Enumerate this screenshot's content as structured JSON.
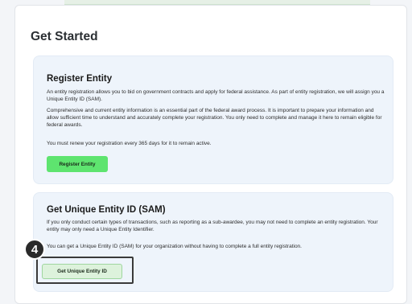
{
  "page": {
    "title": "Get Started"
  },
  "register_entity": {
    "title": "Register Entity",
    "paragraph_1": "An entity registration allows you to bid on government contracts and apply for federal assistance. As part of entity registration, we will assign you a Unique Entity ID (SAM).",
    "paragraph_2": "Comprehensive and current entity information is an essential part of the federal award process. It is important to prepare your information and allow sufficient time to understand and accurately complete your registration. You only need to complete and manage it here to remain eligible for federal awards.",
    "paragraph_3": "You must renew your registration every 365 days for it to remain active.",
    "button_label": "Register Entity"
  },
  "unique_entity_id": {
    "title": "Get Unique Entity ID (SAM)",
    "paragraph_1": "If you only conduct certain types of transactions, such as reporting as a sub-awardee, you may not need to complete an entity registration. Your entity may only need a Unique Entity Identifier.",
    "paragraph_2": "You can get a Unique Entity ID (SAM) for your organization without having to complete a full entity registration.",
    "button_label": "Get Unique Entity ID"
  },
  "annotation": {
    "step_number": "4"
  },
  "colors": {
    "primary_button": "#5ee46f",
    "secondary_button": "#ddf2dc",
    "card_background": "#eef4fb",
    "badge": "#2a2a2a"
  }
}
